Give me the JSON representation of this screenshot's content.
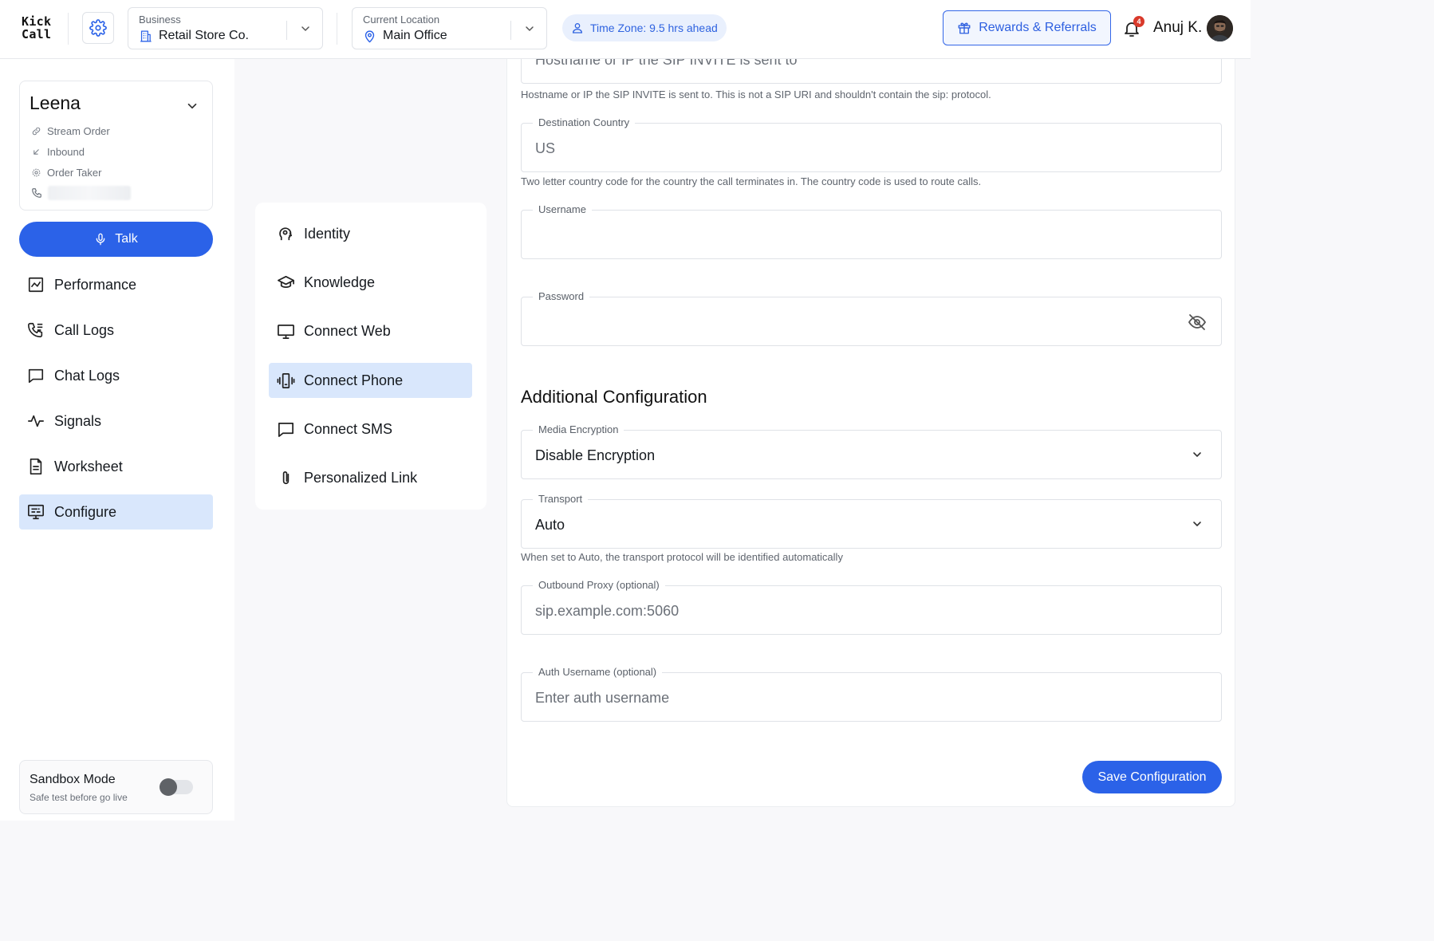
{
  "app": {
    "logo_line1": "Kick",
    "logo_line2": "Call"
  },
  "header": {
    "business": {
      "caption": "Business",
      "value": "Retail Store Co."
    },
    "location": {
      "caption": "Current Location",
      "value": "Main Office"
    },
    "timezone": "Time Zone: 9.5 hrs ahead",
    "rewards_label": "Rewards & Referrals",
    "notification_count": "4",
    "user_name": "Anuj K."
  },
  "agent": {
    "name": "Leena",
    "type": "Stream Order",
    "direction": "Inbound",
    "role": "Order Taker"
  },
  "talk_label": "Talk",
  "nav": [
    {
      "label": "Performance",
      "icon": "chart-icon"
    },
    {
      "label": "Call Logs",
      "icon": "call-log-icon"
    },
    {
      "label": "Chat Logs",
      "icon": "chat-icon"
    },
    {
      "label": "Signals",
      "icon": "pulse-icon"
    },
    {
      "label": "Worksheet",
      "icon": "document-icon"
    },
    {
      "label": "Configure",
      "icon": "configure-icon",
      "active": true
    }
  ],
  "sandbox": {
    "title": "Sandbox Mode",
    "subtitle": "Safe test before go live",
    "enabled": false
  },
  "subnav": [
    {
      "label": "Identity",
      "icon": "head-gear-icon"
    },
    {
      "label": "Knowledge",
      "icon": "graduation-cap-icon"
    },
    {
      "label": "Connect Web",
      "icon": "monitor-icon"
    },
    {
      "label": "Connect Phone",
      "icon": "phone-vibrate-icon",
      "active": true
    },
    {
      "label": "Connect SMS",
      "icon": "message-icon"
    },
    {
      "label": "Personalized Link",
      "icon": "paperclip-icon"
    }
  ],
  "form": {
    "host_field_value": "Hostname or IP the SIP INVITE is sent to",
    "host_hint": "Hostname or IP the SIP INVITE is sent to. This is not a SIP URI and shouldn't contain the sip: protocol.",
    "country": {
      "label": "Destination Country",
      "value": "US"
    },
    "country_hint": "Two letter country code for the country the call terminates in. The country code is used to route calls.",
    "username": {
      "label": "Username",
      "value": ""
    },
    "password": {
      "label": "Password",
      "value": ""
    },
    "additional_title": "Additional Configuration",
    "media_encryption": {
      "label": "Media Encryption",
      "value": "Disable Encryption"
    },
    "transport": {
      "label": "Transport",
      "value": "Auto"
    },
    "transport_hint": "When set to Auto, the transport protocol will be identified automatically",
    "outbound_proxy": {
      "label": "Outbound Proxy (optional)",
      "placeholder": "sip.example.com:5060"
    },
    "auth_username": {
      "label": "Auth Username (optional)",
      "placeholder": "Enter auth username"
    },
    "save_label": "Save Configuration"
  },
  "colors": {
    "accent": "#2b62e8",
    "active_bg": "#d9e7fc",
    "badge": "#d93a2b"
  }
}
